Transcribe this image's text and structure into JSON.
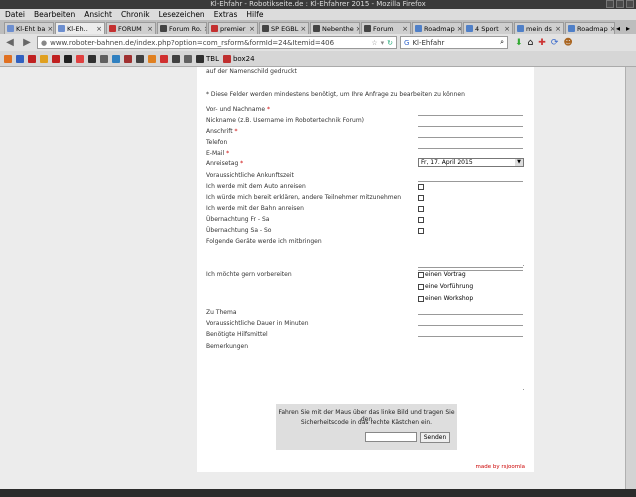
{
  "window": {
    "title": "Kl-Ehfahr - Robotikseite.de : Kl-Ehfahrer 2015 - Mozilla Firefox"
  },
  "menu": [
    "Datei",
    "Bearbeiten",
    "Ansicht",
    "Chronik",
    "Lesezeichen",
    "Extras",
    "Hilfe"
  ],
  "tabs": [
    {
      "label": "Kl-Eht ba",
      "color": "#6d8fd0",
      "active": false
    },
    {
      "label": "Kl-Eh..",
      "color": "#6d8fd0",
      "active": true
    },
    {
      "label": "FORUM",
      "color": "#c43030",
      "active": false
    },
    {
      "label": "Forum Ro.",
      "color": "#444",
      "active": false
    },
    {
      "label": "premier",
      "color": "#c43030",
      "active": false
    },
    {
      "label": "SP EGBL",
      "color": "#444",
      "active": false
    },
    {
      "label": "Nebenthe",
      "color": "#444",
      "active": false
    },
    {
      "label": "Forum",
      "color": "#444",
      "active": false
    },
    {
      "label": "Roadmap",
      "color": "#5080c8",
      "active": false
    },
    {
      "label": "4 Sport",
      "color": "#5080c8",
      "active": false
    },
    {
      "label": "mein ds",
      "color": "#5080c8",
      "active": false
    },
    {
      "label": "Roadmap",
      "color": "#5080c8",
      "active": false
    }
  ],
  "nav": {
    "url": "www.roboter-bahnen.de/index.php?option=com_rsform&formId=24&Itemid=406",
    "search_value": "Kl-Ehfahr"
  },
  "bookmarks": {
    "colors": [
      "#e07020",
      "#3060c0",
      "#c02020",
      "#e0a020",
      "#c02020",
      "#202020",
      "#e04040",
      "#303030",
      "#606060",
      "#3080c0",
      "#a03030",
      "#404040",
      "#e08020",
      "#d03030",
      "#404040",
      "#606060"
    ],
    "items": [
      {
        "label": "TBL",
        "color": "#303030"
      },
      {
        "label": "box24",
        "color": "#c03030"
      }
    ]
  },
  "form": {
    "intro": "auf der Namenschild gedruckt",
    "required_note": "* Diese Felder werden mindestens benötigt, um Ihre Anfrage zu bearbeiten zu können",
    "fields": [
      {
        "label": "Vor- und Nachname",
        "required": true,
        "type": "text"
      },
      {
        "label": "Nickname (z.B. Username im Robotertechnik Forum)",
        "required": false,
        "type": "text"
      },
      {
        "label": "Anschrift",
        "required": true,
        "type": "text"
      },
      {
        "label": "Telefon",
        "required": false,
        "type": "text"
      },
      {
        "label": "E-Mail",
        "required": true,
        "type": "text"
      },
      {
        "label": "Anreisetag",
        "required": true,
        "type": "select",
        "value": "Fr, 17. April 2015"
      },
      {
        "label": "Voraussichtliche Ankunftszeit",
        "required": false,
        "type": "text"
      },
      {
        "label": "Ich werde mit dem Auto anreisen",
        "required": false,
        "type": "checkbox"
      },
      {
        "label": "Ich würde mich bereit erklären, andere Teilnehmer mitzunehmen",
        "required": false,
        "type": "checkbox"
      },
      {
        "label": "Ich werde mit der Bahn anreisen",
        "required": false,
        "type": "checkbox"
      },
      {
        "label": "Übernachtung Fr - Sa",
        "required": false,
        "type": "checkbox"
      },
      {
        "label": "Übernachtung Sa - So",
        "required": false,
        "type": "checkbox"
      },
      {
        "label": "Folgende Geräte werde ich mitbringen",
        "required": false,
        "type": "textarea"
      }
    ],
    "prepare": {
      "label": "Ich möchte gern vorbereiten",
      "options": [
        "einen Vortrag",
        "eine Vorführung",
        "einen Workshop"
      ]
    },
    "extra_fields": [
      {
        "label": "Zu Thema"
      },
      {
        "label": "Voraussichtliche Dauer in Minuten"
      },
      {
        "label": "Benötigte Hilfsmittel"
      },
      {
        "label": "Bemerkungen"
      }
    ],
    "captcha": {
      "line1": "Fahren Sie mit der Maus über das linke Bild und tragen Sie den",
      "line2": "Sicherheitscode in das rechte Kästchen ein.",
      "button": "Senden"
    },
    "footer_link": "made by rsjoomla"
  }
}
